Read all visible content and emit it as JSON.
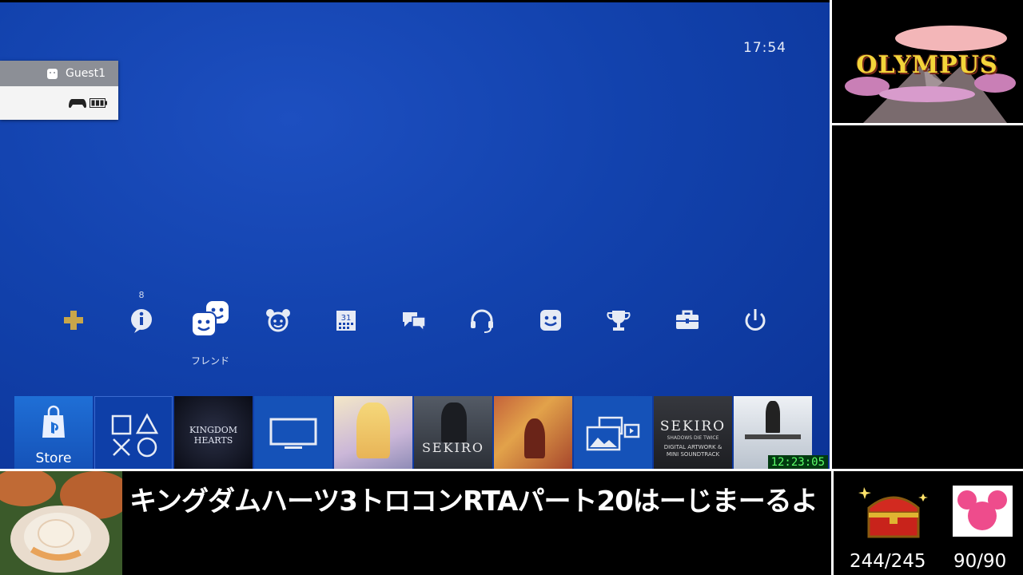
{
  "ps4": {
    "clock": "17:54",
    "user": {
      "name": "Guest1",
      "icon": "face-icon",
      "controller_icon": "controller-icon",
      "battery_icon": "battery-icon"
    },
    "function_row": {
      "notification_count": "8",
      "selected_label": "フレンド",
      "items": [
        {
          "name": "playstation-plus-icon"
        },
        {
          "name": "notifications-icon"
        },
        {
          "name": "friends-icon"
        },
        {
          "name": "party-icon"
        },
        {
          "name": "events-icon"
        },
        {
          "name": "messages-icon"
        },
        {
          "name": "headset-icon"
        },
        {
          "name": "profile-icon"
        },
        {
          "name": "trophies-icon"
        },
        {
          "name": "settings-icon"
        },
        {
          "name": "power-icon"
        }
      ]
    },
    "tiles": {
      "store_label": "Store",
      "kh3_text": "KINGDOM HEARTS",
      "sekiro_text": "SEKIRO",
      "sekiro_art_text": "SEKIRO",
      "sekiro_art_sub": "SHADOWS DIE TWICE",
      "sekiro_art_desc": "DIGITAL ARTWORK &\nMINI SOUNDTRACK"
    }
  },
  "overlay": {
    "timer": "12:23:05",
    "logo_text": "OLYMPUS",
    "title": "キングダムハーツ3トロコンRTAパート20はーじまーるよ",
    "treasure_count": "244/245",
    "mickey_count": "90/90"
  }
}
